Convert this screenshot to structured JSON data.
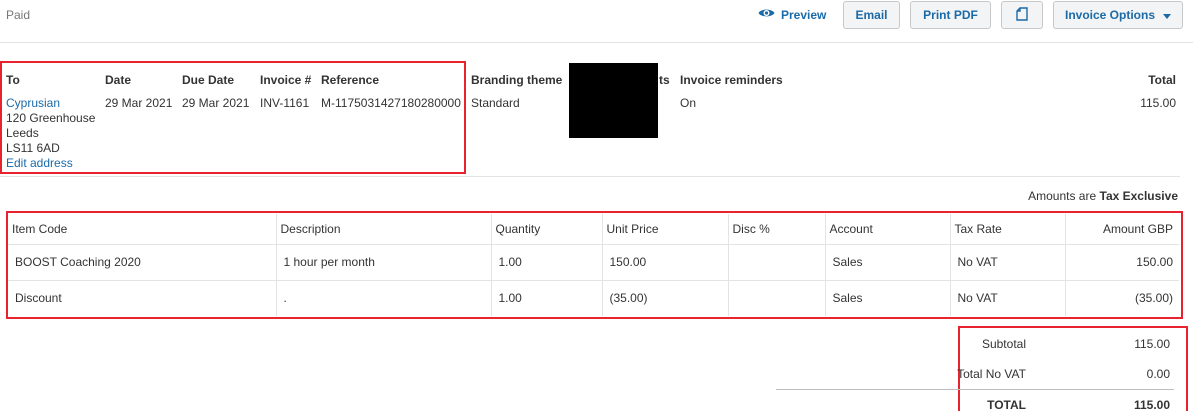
{
  "header": {
    "status": "Paid",
    "preview_label": "Preview",
    "email_label": "Email",
    "print_pdf_label": "Print PDF",
    "invoice_options_label": "Invoice Options"
  },
  "summary": {
    "to_label": "To",
    "date_label": "Date",
    "due_date_label": "Due Date",
    "invoice_number_label": "Invoice #",
    "reference_label": "Reference",
    "branding_theme_label": "Branding theme",
    "hidden_label_fragment": "ts",
    "invoice_reminders_label": "Invoice reminders",
    "total_label": "Total",
    "contact_name": "Cyprusian",
    "address_line1": "120 Greenhouse",
    "address_line2": "Leeds",
    "address_line3": "LS11 6AD",
    "edit_address": "Edit address",
    "date": "29 Mar 2021",
    "due_date": "29 Mar 2021",
    "invoice_number": "INV-1161",
    "reference": "M-1175031427180280000",
    "branding_theme": "Standard",
    "invoice_reminders": "On",
    "total": "115.00"
  },
  "amounts_note": {
    "prefix": "Amounts are",
    "mode": "Tax Exclusive"
  },
  "line_items": {
    "columns": [
      "Item Code",
      "Description",
      "Quantity",
      "Unit Price",
      "Disc %",
      "Account",
      "Tax Rate",
      "Amount GBP"
    ],
    "rows": [
      [
        "BOOST Coaching 2020",
        "1 hour per month",
        "1.00",
        "150.00",
        "",
        "Sales",
        "No VAT",
        "150.00"
      ],
      [
        "Discount",
        ".",
        "1.00",
        "(35.00)",
        "",
        "Sales",
        "No VAT",
        "(35.00)"
      ]
    ]
  },
  "totals": {
    "subtotal_label": "Subtotal",
    "subtotal": "115.00",
    "tax_label": "Total No VAT",
    "tax": "0.00",
    "total_label": "TOTAL",
    "total": "115.00"
  },
  "colors": {
    "accent": "#1b6aa8",
    "highlight": "#e8232f",
    "redaction": "#000000"
  }
}
